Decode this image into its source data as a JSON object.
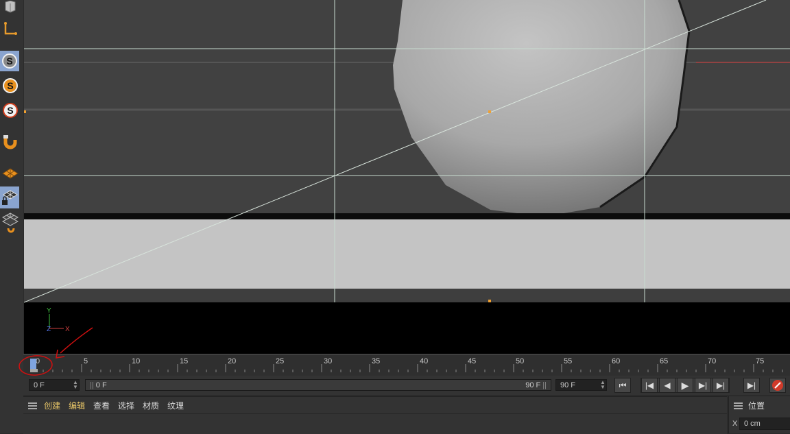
{
  "toolbar": {
    "tools": [
      {
        "name": "cube-icon"
      },
      {
        "name": "axis-l-icon"
      },
      {
        "name": "snap-s-icon",
        "label": "S"
      },
      {
        "name": "snap-s-icon",
        "label": "S"
      },
      {
        "name": "snap-s-icon",
        "label": "S"
      },
      {
        "name": "magnet-icon"
      },
      {
        "name": "grid-plane-icon"
      },
      {
        "name": "locked-grid-icon"
      },
      {
        "name": "grid-options-icon"
      }
    ]
  },
  "viewport": {
    "axis_y": "Y",
    "axis_x": "X",
    "axis_z": "Z"
  },
  "timeline": {
    "ticks": [
      "0",
      "5",
      "10",
      "15",
      "20",
      "25",
      "30",
      "35",
      "40",
      "45",
      "50",
      "55",
      "60",
      "65",
      "70",
      "75"
    ]
  },
  "transport": {
    "current_frame": "0 F",
    "range_start": "0 F",
    "range_end": "90 F",
    "max_frame": "90 F"
  },
  "material_manager": {
    "menu": [
      "创建",
      "编辑",
      "查看",
      "选择",
      "材质",
      "纹理"
    ]
  },
  "attributes": {
    "title": "位置",
    "x_label": "X",
    "x_value": "0 cm"
  },
  "colors": {
    "annotation": "#d01010",
    "accent_orange": "#f0a030",
    "selection_blue": "#8aa4cf"
  }
}
